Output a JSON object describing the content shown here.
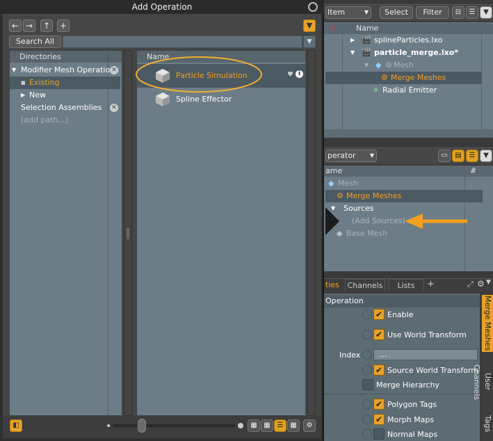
{
  "dialog": {
    "title": "Add Operation",
    "search_button": "Search All",
    "search_value": "",
    "directories_header": "Directories",
    "name_header": "Name",
    "directories": [
      {
        "label": "Modifier Mesh Operations",
        "expanded": true,
        "removable": true
      },
      {
        "label": "Existing",
        "selected": true
      },
      {
        "label": "New"
      },
      {
        "label": "Selection Assemblies",
        "removable": true
      },
      {
        "label": "(add path...)"
      }
    ],
    "operations": [
      {
        "label": "Particle Simulation",
        "highlighted": true
      },
      {
        "label": "Spline Effector"
      }
    ]
  },
  "item_list": {
    "dropdown_value": "Item",
    "select_label": "Select",
    "filter_label": "Filter",
    "name_header": "Name",
    "rows": [
      {
        "label": "splineParticles.lxo"
      },
      {
        "label": "particle_merge.lxo*"
      },
      {
        "label": "Mesh"
      },
      {
        "label": "Merge Meshes"
      },
      {
        "label": "Radial Emitter"
      }
    ]
  },
  "schematic": {
    "dropdown_value": "perator",
    "name_header": "ame",
    "hash_header": "#",
    "rows": [
      {
        "label": "Mesh"
      },
      {
        "label": "Merge Meshes"
      },
      {
        "label": "Sources"
      },
      {
        "label": "(Add Sources)"
      },
      {
        "label": "Base Mesh"
      }
    ]
  },
  "properties": {
    "tabs": [
      "ties",
      "Channels",
      "Lists"
    ],
    "add_tab": "+",
    "section": "Operation",
    "index_label": "Index",
    "index_value": "...",
    "items": [
      {
        "label": "Enable",
        "checked": true
      },
      {
        "label": "Use World Transform",
        "checked": true
      },
      {
        "label": "Source World Transform",
        "checked": true
      },
      {
        "label": "Merge Hierarchy",
        "checked": false
      },
      {
        "label": "Polygon Tags",
        "checked": true
      },
      {
        "label": "Morph Maps",
        "checked": true
      },
      {
        "label": "Normal Maps",
        "checked": false
      }
    ],
    "side_tabs": [
      "Merge Meshes",
      "User Channels",
      "Tags"
    ]
  },
  "colors": {
    "accent": "#f3a020",
    "panel": "#6d7d87",
    "highlight_ring": "#f0b030"
  }
}
